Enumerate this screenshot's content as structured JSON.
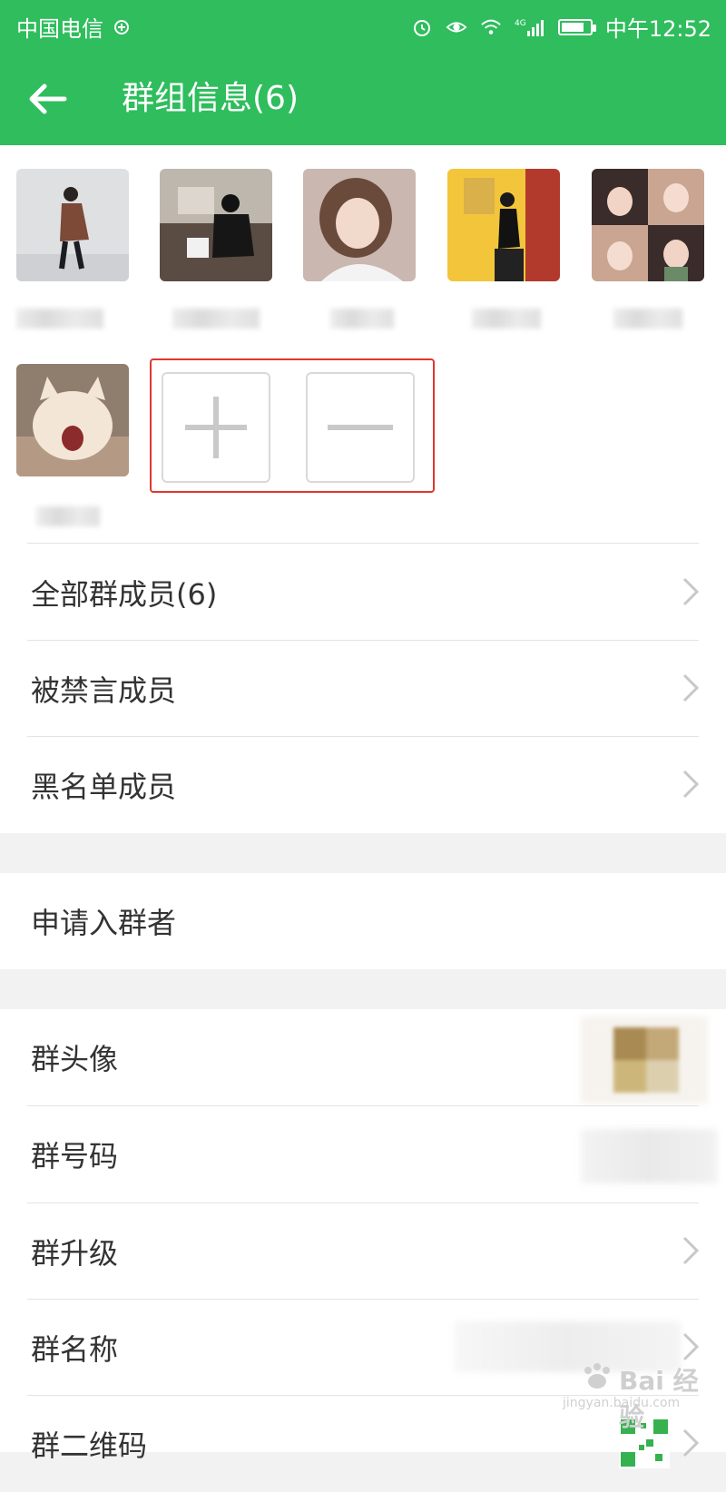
{
  "status_bar": {
    "carrier": "中国电信",
    "time": "中午12:52",
    "network": "4G",
    "icons": [
      "alarm-icon",
      "eye-icon",
      "wifi-icon",
      "signal-icon",
      "battery-icon"
    ]
  },
  "header": {
    "title": "群组信息(6)",
    "back_icon": "back-arrow-icon"
  },
  "members": {
    "count": 6,
    "avatars": [
      "member-avatar-1",
      "member-avatar-2",
      "member-avatar-3",
      "member-avatar-4",
      "member-avatar-5",
      "member-avatar-6"
    ],
    "add_icon": "plus-icon",
    "remove_icon": "minus-icon"
  },
  "rows": [
    {
      "label": "全部群成员(6)",
      "chevron": true
    },
    {
      "label": "被禁言成员",
      "chevron": true
    },
    {
      "label": "黑名单成员",
      "chevron": true
    },
    {
      "label": "申请入群者",
      "chevron": false
    },
    {
      "label": "群头像",
      "chevron": false
    },
    {
      "label": "群号码",
      "chevron": false
    },
    {
      "label": "群升级",
      "chevron": true
    },
    {
      "label": "群名称",
      "chevron": true
    },
    {
      "label": "群二维码",
      "chevron": true
    }
  ],
  "watermark": {
    "text": "Bai 经验",
    "sub": "jingyan.baidu.com"
  },
  "colors": {
    "accent": "#2fbd5d",
    "highlight_border": "#e0362c"
  }
}
